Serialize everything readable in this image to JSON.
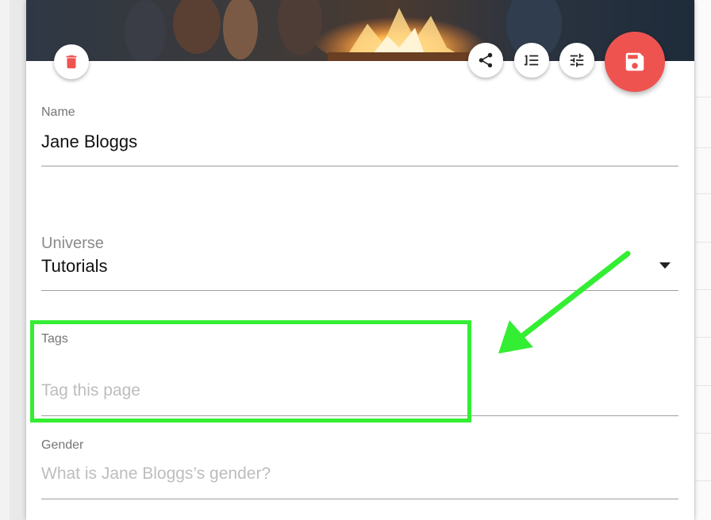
{
  "form": {
    "name": {
      "label": "Name",
      "value": "Jane Bloggs"
    },
    "universe": {
      "label": "Universe",
      "value": "Tutorials"
    },
    "tags": {
      "label": "Tags",
      "placeholder": "Tag this page"
    },
    "gender": {
      "label": "Gender",
      "placeholder": "What is Jane Bloggs’s gender?"
    }
  },
  "actions": {
    "delete_icon": "trash-icon",
    "share_icon": "share-icon",
    "reorder_icon": "format-list-numbered-icon",
    "tune_icon": "tune-icon",
    "save_icon": "save-floppy-icon"
  },
  "colors": {
    "save_fab": "#ef5350",
    "delete_icon": "#ef5350",
    "annotation": "#33ee33",
    "field_underline": "#9e9e9e",
    "placeholder": "#bdbdbd"
  }
}
